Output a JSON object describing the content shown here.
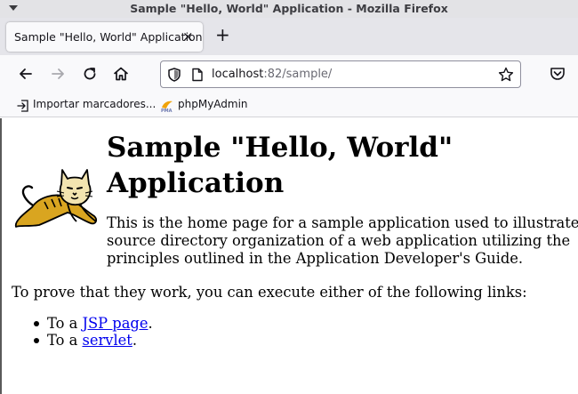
{
  "window": {
    "title": "Sample \"Hello, World\" Application - Mozilla Firefox"
  },
  "tabs": [
    {
      "label": "Sample \"Hello, World\" Application",
      "close": "×"
    }
  ],
  "new_tab": "+",
  "urlbar": {
    "host": "localhost",
    "path": ":82/sample/"
  },
  "bookmarks": [
    {
      "label": "Importar marcadores...",
      "icon": "import-icon"
    },
    {
      "label": "phpMyAdmin",
      "icon": "phpmyadmin-icon"
    }
  ],
  "page": {
    "title": "Sample \"Hello, World\" Application",
    "intro": "This is the home page for a sample application used to illustrate the source directory organization of a web application utilizing the principles outlined in the Application Developer's Guide.",
    "prove": "To prove that they work, you can execute either of the following links:",
    "links": [
      {
        "prefix": "To a ",
        "link": "JSP page",
        "suffix": "."
      },
      {
        "prefix": "To a ",
        "link": "servlet",
        "suffix": "."
      }
    ]
  },
  "colors": {
    "link": "#0000ee",
    "tomcat_yellow": "#d9a520"
  }
}
